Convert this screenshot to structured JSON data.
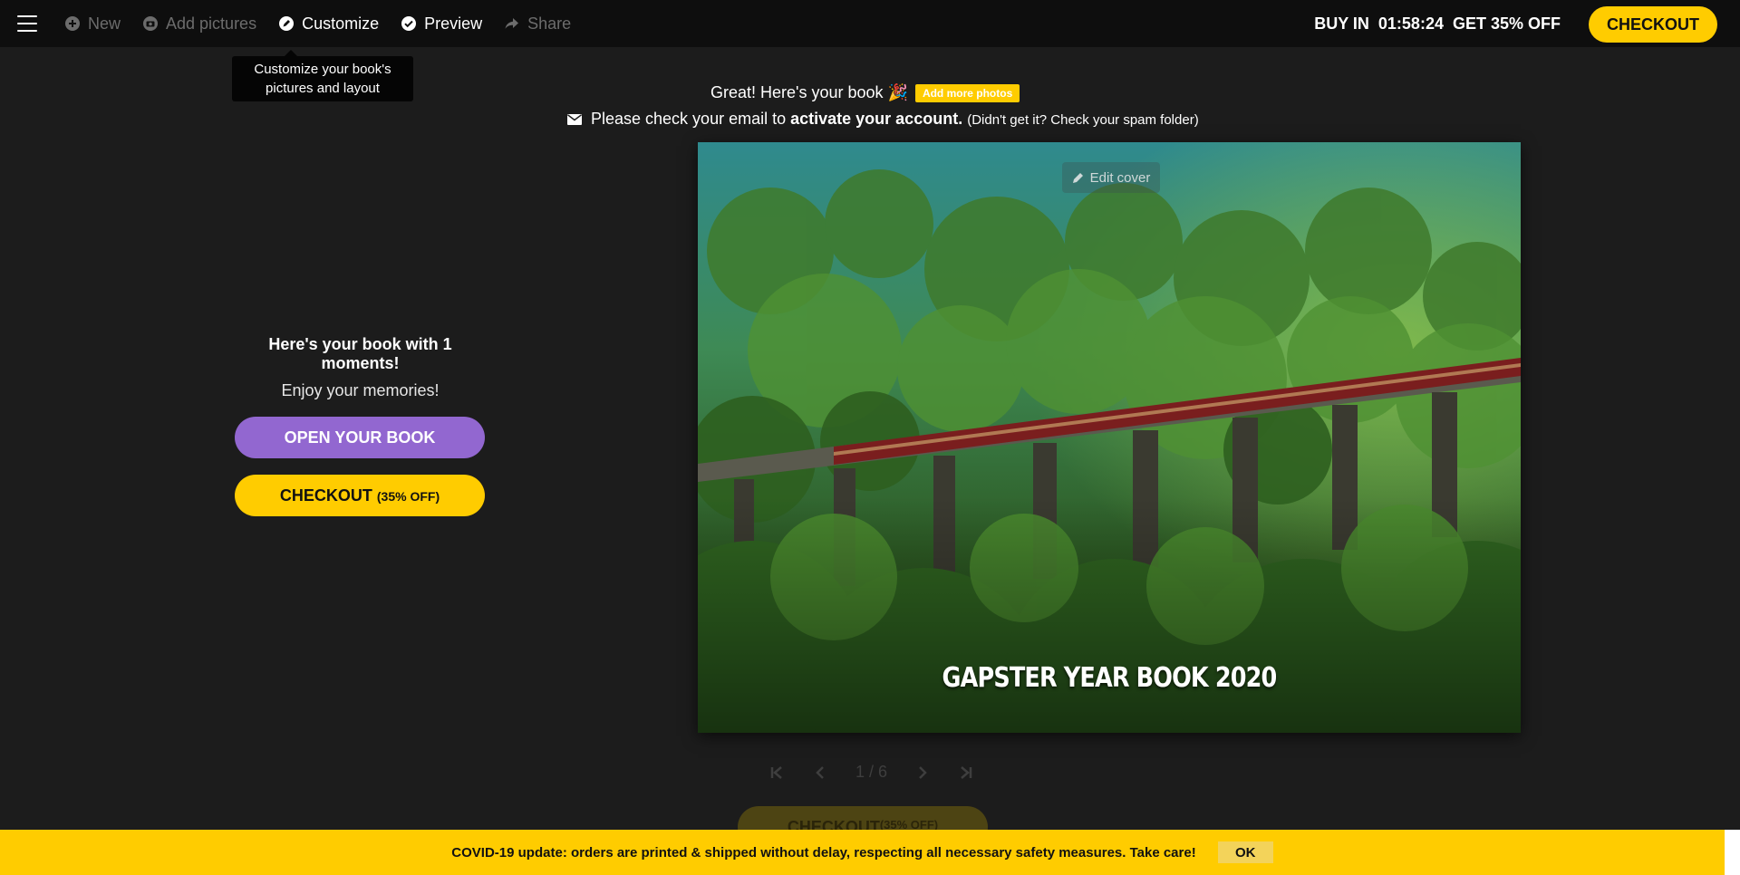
{
  "nav": {
    "items": [
      {
        "label": "New",
        "state": "disabled",
        "icon": "plus-circle-icon"
      },
      {
        "label": "Add pictures",
        "state": "disabled",
        "icon": "camera-icon"
      },
      {
        "label": "Customize",
        "state": "active",
        "icon": "edit-circle-icon"
      },
      {
        "label": "Preview",
        "state": "active",
        "icon": "check-circle-icon"
      },
      {
        "label": "Share",
        "state": "disabled",
        "icon": "share-arrow-icon"
      }
    ],
    "promo_buy_in": "BUY IN",
    "promo_timer": "01:58:24",
    "promo_discount": "GET 35% OFF",
    "checkout_label": "CHECKOUT"
  },
  "tooltip": {
    "line1": "Customize your book's",
    "line2": "pictures and layout"
  },
  "header": {
    "great_text": "Great! Here's your book 🎉",
    "add_photos_label": "Add more photos",
    "email_prefix": "Please check your email to",
    "email_strong": "activate your account.",
    "email_hint": "(Didn't get it? Check your spam folder)"
  },
  "left_panel": {
    "title": "Here's your book with 1 moments!",
    "subtitle": "Enjoy your memories!",
    "open_label": "OPEN YOUR BOOK",
    "checkout_label": "CHECKOUT",
    "checkout_discount": "(35% OFF)"
  },
  "cover": {
    "edit_label": "Edit cover",
    "title": "GAPSTER YEAR BOOK 2020"
  },
  "pager": {
    "text": "1 / 6"
  },
  "ghost_checkout": {
    "label": "CHECKOUT",
    "discount": "(35% OFF)"
  },
  "banner": {
    "text": "COVID-19 update: orders are printed & shipped without delay, respecting all necessary safety measures. Take care!",
    "ok_label": "OK"
  },
  "colors": {
    "accent_yellow": "#ffcc00",
    "accent_purple": "#9267d0",
    "background": "#1c1c1c",
    "topbar": "#0e0e0e"
  }
}
